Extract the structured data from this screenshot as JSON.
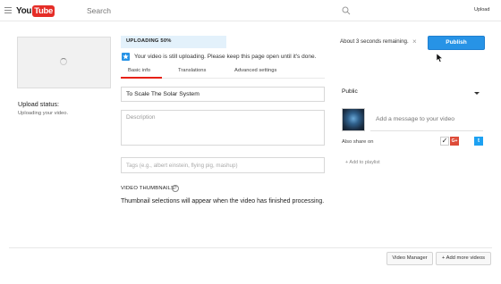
{
  "masthead": {
    "logo_you": "You",
    "logo_tube": "Tube",
    "search_placeholder": "Search",
    "upload_label": "Upload"
  },
  "left": {
    "upload_status_title": "Upload status:",
    "upload_status_text": "Uploading your video."
  },
  "progress": {
    "label": "UPLOADING 50%",
    "percent": 50,
    "remaining": "About 3 seconds remaining.",
    "publish_label": "Publish"
  },
  "notice": {
    "text": "Your video is still uploading. Please keep this page open until it's done."
  },
  "tabs": [
    {
      "label": "Basic info",
      "active": true
    },
    {
      "label": "Translations",
      "active": false
    },
    {
      "label": "Advanced settings",
      "active": false
    }
  ],
  "form": {
    "title_value": "To Scale  The Solar System",
    "description_placeholder": "Description",
    "tags_placeholder": "Tags (e.g., albert einstein, flying pig, mashup)",
    "thumbnails_heading": "VIDEO THUMBNAILS",
    "thumbnails_text": "Thumbnail selections will appear when the video has finished processing."
  },
  "right": {
    "privacy_value": "Public",
    "message_placeholder": "Add a message to your video",
    "also_share_label": "Also share on",
    "add_to_playlist": "+ Add to playlist"
  },
  "bottom": {
    "video_manager_label": "Video Manager",
    "add_more_label": "+ Add more videos"
  },
  "colors": {
    "publish_blue": "#2793e6",
    "progress_fill": "#e3f1fb",
    "tab_active_red": "#e62117",
    "logo_red": "#e52d27"
  }
}
